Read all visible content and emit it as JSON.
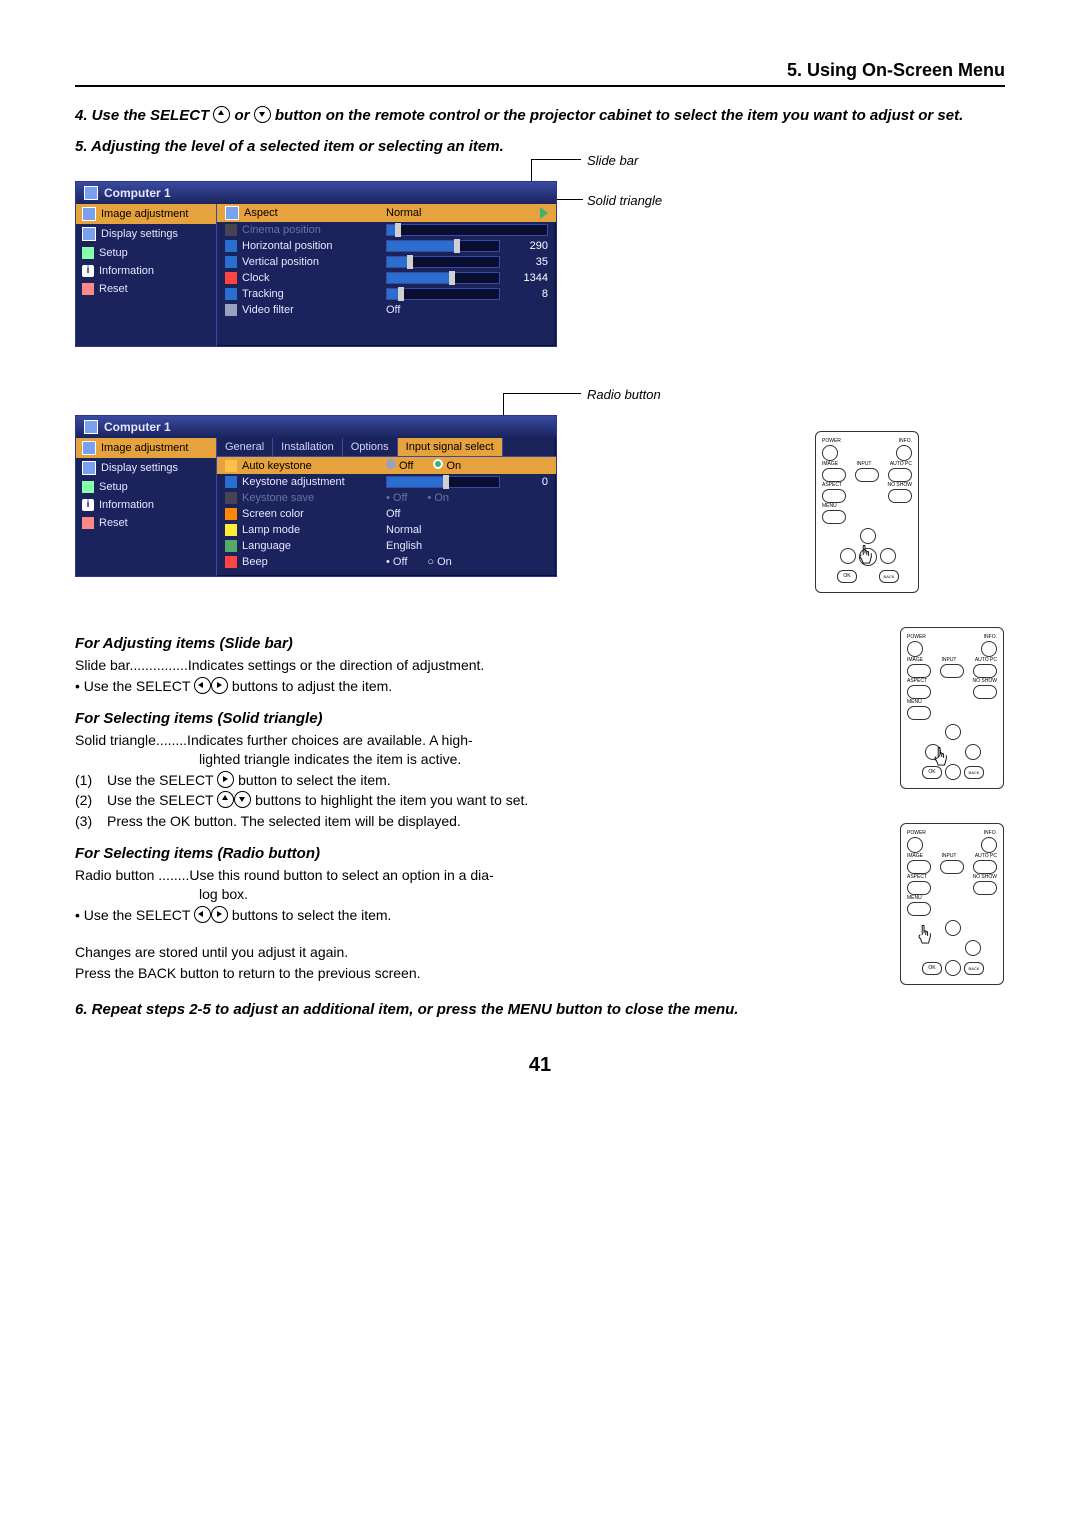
{
  "header": {
    "title": "5. Using On-Screen Menu"
  },
  "steps": {
    "s4": "4. Use the SELECT ▲ or ▼ button on the remote control or the projector cabinet to select the item you want to adjust or set.",
    "s5": "5. Adjusting the level of a selected item or selecting an item.",
    "s6": "6. Repeat steps 2-5 to adjust an additional item, or press the MENU button to close the menu."
  },
  "callouts": {
    "slide_bar": "Slide bar",
    "solid_triangle": "Solid triangle",
    "radio_button": "Radio button"
  },
  "osd1": {
    "title": "Computer 1",
    "sidebar": [
      {
        "label": "Image adjustment",
        "selected": true
      },
      {
        "label": "Display settings",
        "selected": false
      },
      {
        "label": "Setup",
        "selected": false
      },
      {
        "label": "Information",
        "selected": false
      },
      {
        "label": "Reset",
        "selected": false
      }
    ],
    "rows": [
      {
        "label": "Aspect",
        "value": "Normal",
        "selected": true,
        "triangle": true
      },
      {
        "label": "Cinema position",
        "disabled": true,
        "slider": {
          "fill": 5,
          "knob": 5
        }
      },
      {
        "label": "Horizontal position",
        "slider": {
          "fill": 60,
          "knob": 60
        },
        "num": "290"
      },
      {
        "label": "Vertical position",
        "slider": {
          "fill": 18,
          "knob": 18
        },
        "num": "35"
      },
      {
        "label": "Clock",
        "slider": {
          "fill": 55,
          "knob": 55
        },
        "num": "1344"
      },
      {
        "label": "Tracking",
        "slider": {
          "fill": 10,
          "knob": 10
        },
        "num": "8"
      },
      {
        "label": "Video filter",
        "value": "Off"
      }
    ]
  },
  "osd2": {
    "title": "Computer 1",
    "sidebar": [
      {
        "label": "Image adjustment",
        "selected": false,
        "orange": true
      },
      {
        "label": "Display settings",
        "selected": false
      },
      {
        "label": "Setup",
        "selected": true
      },
      {
        "label": "Information",
        "selected": false
      },
      {
        "label": "Reset",
        "selected": false
      }
    ],
    "tabs": [
      "General",
      "Installation",
      "Options",
      "Input signal select"
    ],
    "tab_selected": 3,
    "rows": [
      {
        "label": "Auto keystone",
        "radioOff": true,
        "radioOn": true,
        "radioState": "on",
        "selected": true
      },
      {
        "label": "Keystone adjustment",
        "slider": {
          "fill": 50,
          "knob": 50
        },
        "num": "0"
      },
      {
        "label": "Keystone save",
        "radioOff": true,
        "radioOn": true,
        "disabled": true,
        "offBullet": true
      },
      {
        "label": "Screen color",
        "value": "Off"
      },
      {
        "label": "Lamp mode",
        "value": "Normal"
      },
      {
        "label": "Language",
        "value": "English"
      },
      {
        "label": "Beep",
        "radioOff": true,
        "radioOn": true,
        "radioState": "off",
        "offBullet": true,
        "onCircle": true
      }
    ],
    "radio_labels": {
      "off": "Off",
      "on": "On"
    }
  },
  "body": {
    "h_slide": "For Adjusting items (Slide bar)",
    "slide_line": "Slide bar...............Indicates settings or the direction of adjustment.",
    "slide_bullet": "• Use the SELECT ◀▶ buttons to adjust the item.",
    "h_triangle": "For Selecting items (Solid triangle)",
    "tri_line": "Solid triangle........Indicates further choices are available. A highlighted triangle indicates the item is active.",
    "tri_1": "Use the SELECT ▶ button to select the item.",
    "tri_2": "Use the SELECT ▲▼ buttons to highlight the item you want to set.",
    "tri_3": "Press the OK button. The selected item will be displayed.",
    "h_radio": "For Selecting items (Radio button)",
    "radio_line": "Radio button ........Use this round button to select an option in a dialog box.",
    "radio_bullet": "• Use the SELECT ◀▶ buttons to select the item.",
    "stored": "Changes are stored until you adjust it again.",
    "back": "Press the BACK button to return to the previous screen."
  },
  "remote": {
    "power": "POWER",
    "info": "INFO.",
    "image": "IMAGE",
    "input": "INPUT",
    "autopc": "AUTO PC",
    "aspect": "ASPECT",
    "noshow": "NO SHOW",
    "menu": "MENU",
    "ok": "OK",
    "back_btn": "BACK"
  },
  "page_number": "41"
}
